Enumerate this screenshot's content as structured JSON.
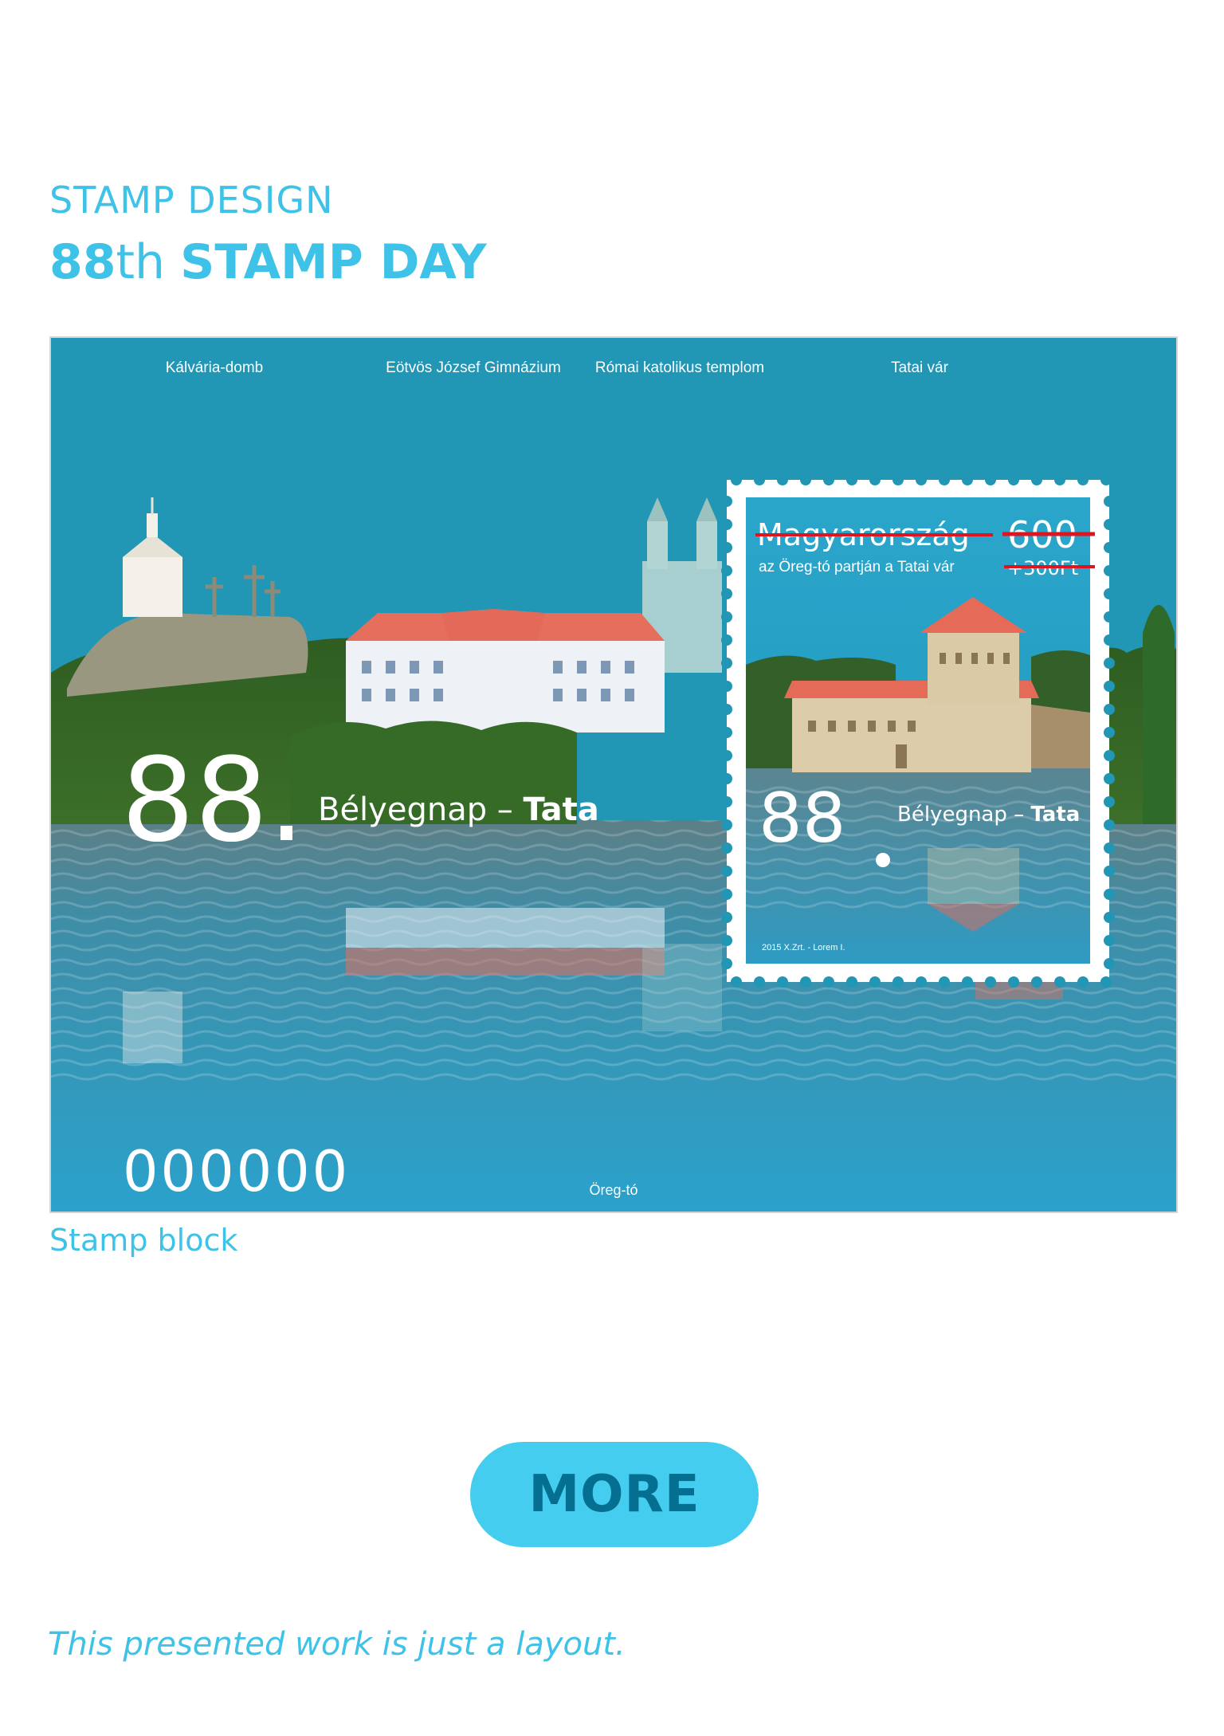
{
  "header": {
    "eyebrow": "STAMP DESIGN",
    "title_number": "88",
    "title_suffix": "th",
    "title_rest": "STAMP DAY"
  },
  "stamp_block": {
    "landmarks": [
      "Kálvária-domb",
      "Eötvös József Gimnázium",
      "Római katolikus templom",
      "Tatai vár"
    ],
    "lake_label": "Öreg-tó",
    "big_number": "88.",
    "event_label": "Bélyegnap –",
    "event_city": "Tata",
    "serial_number": "000000",
    "stamp": {
      "country": "Magyarország",
      "value": "600",
      "surcharge": "+300Ft",
      "subtitle": "az Öreg-tó partján a Tatai vár",
      "big_number": "88",
      "event_label": "Bélyegnap –",
      "event_city": "Tata",
      "imprint": "2015   X.Zrt. - Lorem I."
    }
  },
  "caption": "Stamp block",
  "more_button": "MORE",
  "disclaimer": "This presented work is just a layout.",
  "colors": {
    "accent": "#3fc2e7",
    "button_bg": "#45cdf0",
    "button_text": "#046f91",
    "block_bg": "#2196b5",
    "strike_red": "#e0141e"
  }
}
